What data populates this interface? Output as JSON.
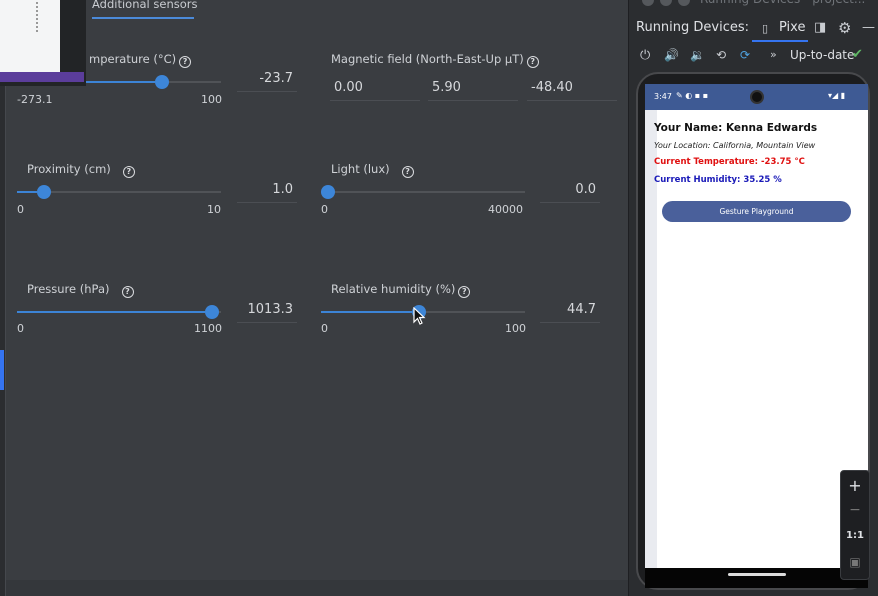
{
  "sensors_tab": "Additional sensors",
  "sensors": {
    "temperature": {
      "label": "Temperature (°C)",
      "visible_label": "mperature (°C)",
      "min": "-273.1",
      "max": "100",
      "value": "-23.7",
      "level": 0.676
    },
    "magnetic": {
      "label": "Magnetic field (North-East-Up µT)",
      "x": "0.00",
      "y": "5.90",
      "z": "-48.40"
    },
    "proximity": {
      "label": "Proximity (cm)",
      "min": "0",
      "max": "10",
      "value": "1.0",
      "level": 0.1
    },
    "light": {
      "label": "Light (lux)",
      "min": "0",
      "max": "40000",
      "value": "0.0",
      "level": 0.0
    },
    "pressure": {
      "label": "Pressure (hPa)",
      "min": "0",
      "max": "1100",
      "value": "1013.3",
      "level": 0.921
    },
    "humidity": {
      "label": "Relative humidity (%)",
      "min": "0",
      "max": "100",
      "value": "44.7",
      "level": 0.447
    }
  },
  "help_glyph": "?",
  "window_title": "Running Devices - project...",
  "devices": {
    "header": "Running Devices:",
    "tab": "Pixe",
    "status": "Up-to-date",
    "check": "✔",
    "toolbar_icons": [
      "power-icon",
      "volume-up-icon",
      "volume-down-icon",
      "rotate-left-icon",
      "rotate-right-icon",
      "more-icon"
    ]
  },
  "phone": {
    "time": "3:47",
    "name": "Your Name: Kenna Edwards",
    "location": "Your Location: California, Mountain View",
    "temperature": "Current Temperature: -23.75 °C",
    "humidity": "Current Humidity: 35.25 %",
    "button": "Gesture Playground"
  },
  "zoom": {
    "plus": "+",
    "minus": "−",
    "one_to_one": "1:1"
  },
  "colors": {
    "accent": "#3d86d8",
    "temp_text": "#e01010",
    "humidity_text": "#1a1ab8",
    "status_bar": "#3e5a94",
    "check": "#5fb865"
  }
}
